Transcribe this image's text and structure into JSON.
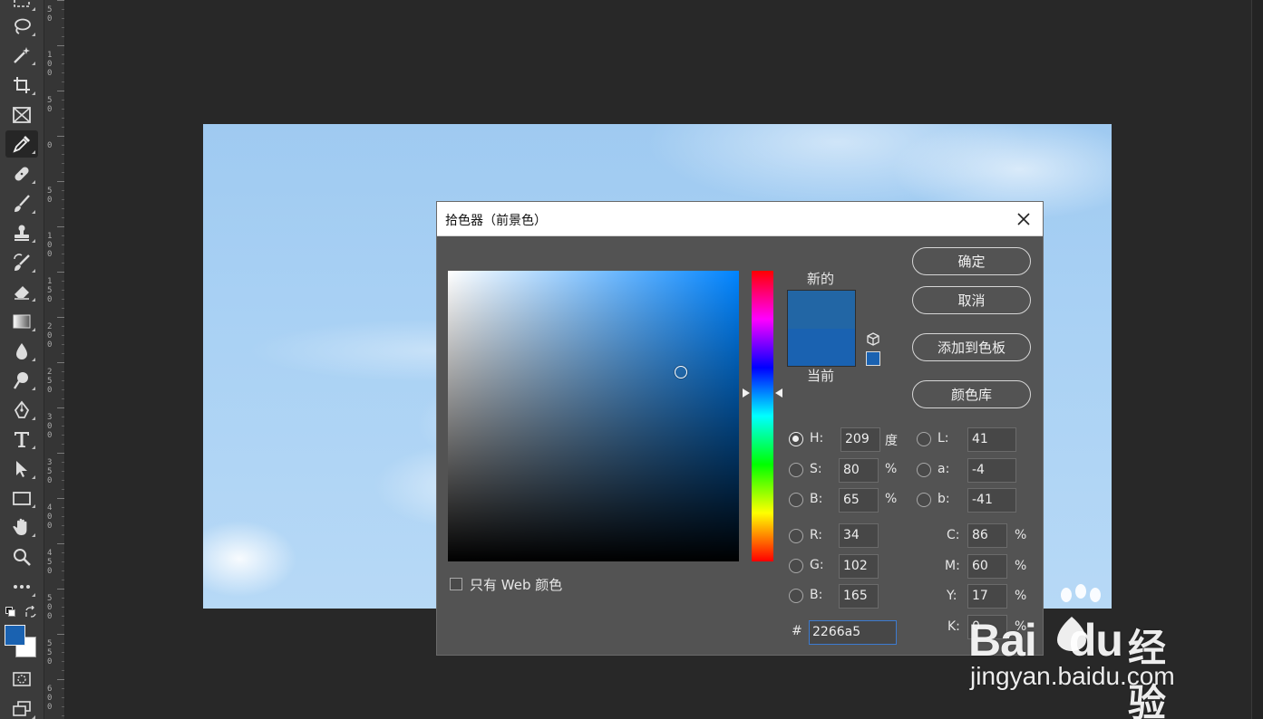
{
  "ruler": {
    "ticks": [
      {
        "digits": [
          "5",
          "0"
        ]
      },
      {
        "digits": [
          "1",
          "0",
          "0"
        ]
      },
      {
        "digits": [
          "5",
          "0"
        ]
      },
      {
        "digits": [
          "0"
        ]
      },
      {
        "digits": [
          "5",
          "0"
        ]
      },
      {
        "digits": [
          "1",
          "0",
          "0"
        ]
      },
      {
        "digits": [
          "1",
          "5",
          "0"
        ]
      },
      {
        "digits": [
          "2",
          "0",
          "0"
        ]
      },
      {
        "digits": [
          "2",
          "5",
          "0"
        ]
      },
      {
        "digits": [
          "3",
          "0",
          "0"
        ]
      },
      {
        "digits": [
          "3",
          "5",
          "0"
        ]
      },
      {
        "digits": [
          "4",
          "0",
          "0"
        ]
      },
      {
        "digits": [
          "4",
          "5",
          "0"
        ]
      },
      {
        "digits": [
          "5",
          "0",
          "0"
        ]
      },
      {
        "digits": [
          "5",
          "5",
          "0"
        ]
      },
      {
        "digits": [
          "6",
          "0",
          "0"
        ]
      }
    ]
  },
  "toolbar": {
    "foreground_color": "#1a62b1",
    "background_color": "#ffffff",
    "active_tool": "eyedropper"
  },
  "dialog": {
    "title": "拾色器（前景色）",
    "label_new": "新的",
    "label_current": "当前",
    "new_color": "#2266a5",
    "current_color": "#1a62b1",
    "buttons": {
      "ok": "确定",
      "cancel": "取消",
      "add_to_swatches": "添加到色板",
      "color_libraries": "颜色库"
    },
    "fields": {
      "H": {
        "label": "H:",
        "value": "209",
        "unit": "度"
      },
      "S": {
        "label": "S:",
        "value": "80",
        "unit": "%"
      },
      "Bv": {
        "label": "B:",
        "value": "65",
        "unit": "%"
      },
      "R": {
        "label": "R:",
        "value": "34"
      },
      "G": {
        "label": "G:",
        "value": "102"
      },
      "Bc": {
        "label": "B:",
        "value": "165"
      },
      "L": {
        "label": "L:",
        "value": "41"
      },
      "a": {
        "label": "a:",
        "value": "-4"
      },
      "b": {
        "label": "b:",
        "value": "-41"
      },
      "C": {
        "label": "C:",
        "value": "86",
        "unit": "%"
      },
      "M": {
        "label": "M:",
        "value": "60",
        "unit": "%"
      },
      "Y": {
        "label": "Y:",
        "value": "17",
        "unit": "%"
      },
      "K": {
        "label": "K:",
        "value": "0",
        "unit": "%"
      }
    },
    "hex_label": "#",
    "hex_value": "2266a5",
    "web_only_label": "只有 Web 颜色",
    "web_only_checked": false,
    "hue_degrees": 209,
    "saturation": 0.8,
    "brightness": 0.65
  },
  "watermark": {
    "brand": "Bai",
    "brand2": "du",
    "suffix": "经验",
    "url": "jingyan.baidu.com"
  }
}
